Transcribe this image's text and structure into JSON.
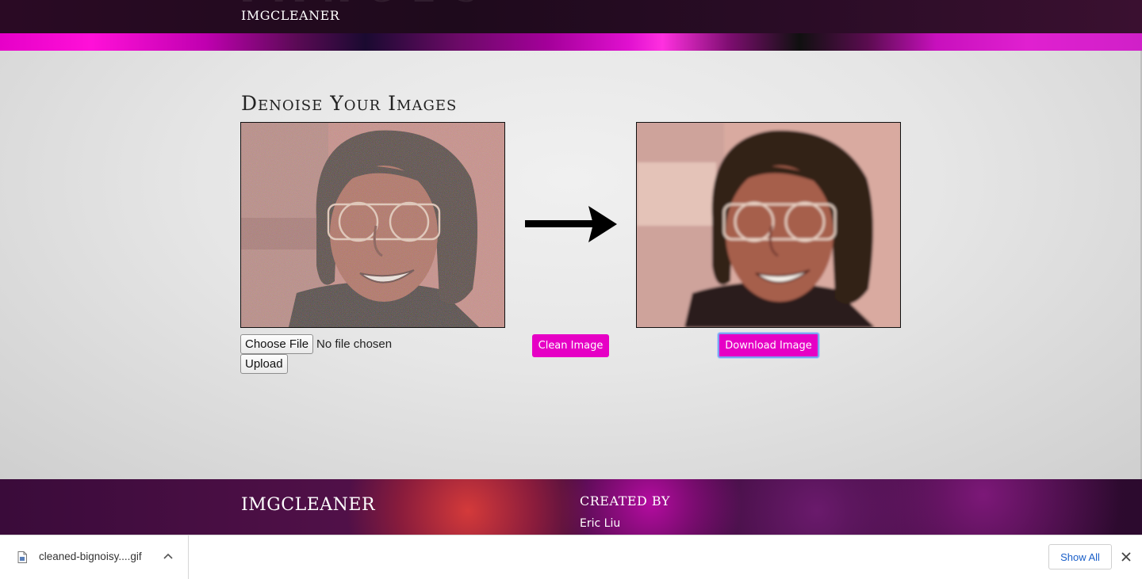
{
  "header": {
    "brand": "IMGCLEANER"
  },
  "main": {
    "title": "Denoise Your Images",
    "file_input": {
      "button_label": "Choose File",
      "status": "No file chosen"
    },
    "upload_label": "Upload",
    "clean_label": "Clean Image",
    "download_label": "Download Image"
  },
  "footer": {
    "brand": "IMGCLEANER",
    "created_by_heading": "CREATED BY",
    "author": "Eric Liu"
  },
  "download_bar": {
    "file_name": "cleaned-bignoisy....gif",
    "show_all_label": "Show All",
    "file_icon": "file-icon",
    "expand_icon": "chevron-up-icon",
    "close_icon": "close-icon"
  },
  "colors": {
    "accent": "#e600c5",
    "link_blue": "#1a5fc9",
    "header_dark": "#1e0a1c"
  }
}
